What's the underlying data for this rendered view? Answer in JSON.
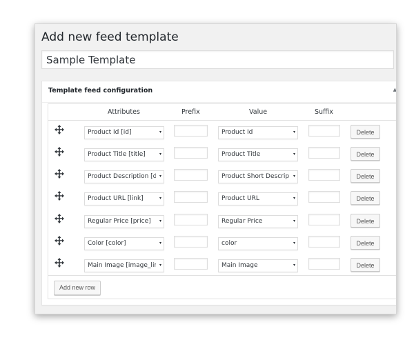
{
  "page": {
    "title": "Add new feed template",
    "template_name": "Sample Template"
  },
  "config_box": {
    "title": "Template feed configuration",
    "toggle_icon": "collapse-arrow-icon"
  },
  "table": {
    "headers": {
      "attributes": "Attributes",
      "prefix": "Prefix",
      "value": "Value",
      "suffix": "Suffix"
    },
    "rows": [
      {
        "attribute": "Product Id [id]",
        "prefix": "",
        "value": "Product Id",
        "suffix": "",
        "delete_label": "Delete"
      },
      {
        "attribute": "Product Title [title]",
        "prefix": "",
        "value": "Product Title",
        "suffix": "",
        "delete_label": "Delete"
      },
      {
        "attribute": "Product Description [d",
        "prefix": "",
        "value": "Product Short Descrip",
        "suffix": "",
        "delete_label": "Delete"
      },
      {
        "attribute": "Product URL [link]",
        "prefix": "",
        "value": "Product URL",
        "suffix": "",
        "delete_label": "Delete"
      },
      {
        "attribute": "Regular Price [price]",
        "prefix": "",
        "value": "Regular Price",
        "suffix": "",
        "delete_label": "Delete"
      },
      {
        "attribute": "Color [color]",
        "prefix": "",
        "value": "color",
        "suffix": "",
        "delete_label": "Delete"
      },
      {
        "attribute": "Main Image [image_lir",
        "prefix": "",
        "value": "Main Image",
        "suffix": "",
        "delete_label": "Delete"
      }
    ],
    "drag_icon": "move-icon",
    "select_caret": "▾",
    "add_row_label": "Add new row"
  }
}
